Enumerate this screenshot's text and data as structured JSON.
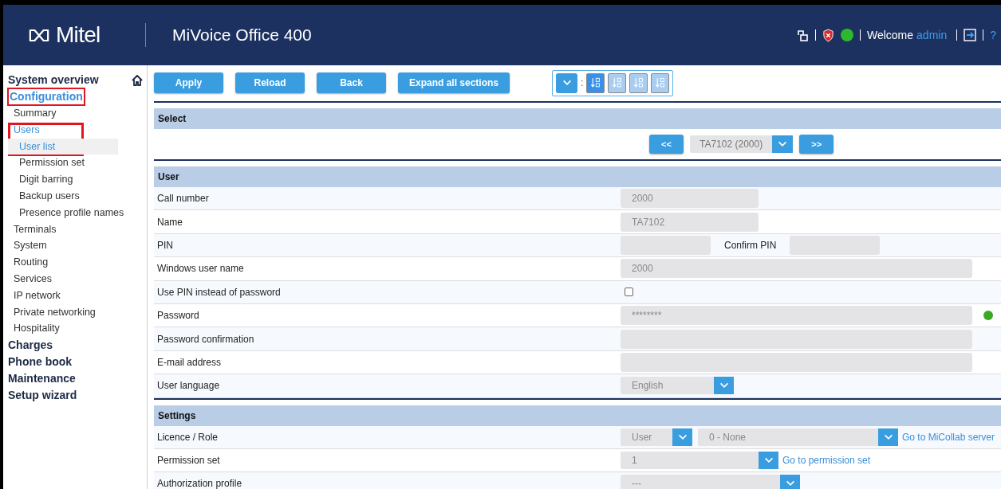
{
  "header": {
    "logo": "Mitel",
    "title": "MiVoice Office 400",
    "welcome": "Welcome",
    "user": "admin",
    "help": "?"
  },
  "sidebar": {
    "items": [
      {
        "label": "System overview",
        "selected": false,
        "highlighted": false
      },
      {
        "label": "Configuration",
        "selected": true,
        "highlighted": true,
        "children": [
          {
            "label": "Summary",
            "selected": false,
            "highlighted": false
          },
          {
            "label": "Users",
            "selected": true,
            "highlighted": true,
            "children": [
              {
                "label": "User list",
                "selected": true,
                "highlighted": true
              },
              {
                "label": "Permission set",
                "selected": false,
                "highlighted": false
              },
              {
                "label": "Digit barring",
                "selected": false,
                "highlighted": false
              },
              {
                "label": "Backup users",
                "selected": false,
                "highlighted": false
              },
              {
                "label": "Presence profile names",
                "selected": false,
                "highlighted": false
              }
            ]
          },
          {
            "label": "Terminals",
            "selected": false,
            "highlighted": false
          },
          {
            "label": "System",
            "selected": false,
            "highlighted": false
          },
          {
            "label": "Routing",
            "selected": false,
            "highlighted": false
          },
          {
            "label": "Services",
            "selected": false,
            "highlighted": false
          },
          {
            "label": "IP network",
            "selected": false,
            "highlighted": false
          },
          {
            "label": "Private networking",
            "selected": false,
            "highlighted": false
          },
          {
            "label": "Hospitality",
            "selected": false,
            "highlighted": false
          }
        ]
      },
      {
        "label": "Charges",
        "selected": false,
        "highlighted": false
      },
      {
        "label": "Phone book",
        "selected": false,
        "highlighted": false
      },
      {
        "label": "Maintenance",
        "selected": false,
        "highlighted": false
      },
      {
        "label": "Setup wizard",
        "selected": false,
        "highlighted": false
      }
    ]
  },
  "toolbar": {
    "buttons": [
      "Apply",
      "Reload",
      "Back",
      "Expand all sections"
    ],
    "sort_separator": ":",
    "sort_buttons": [
      {
        "selected": true
      },
      {
        "selected": false
      },
      {
        "selected": false
      },
      {
        "selected": false
      }
    ]
  },
  "select_section": {
    "title": "Select",
    "prev": "<<",
    "current": "TA7102 (2000)",
    "next": ">>"
  },
  "sections": [
    {
      "title": "User",
      "rows": [
        {
          "label": "Call number",
          "fields": [
            {
              "kind": "input",
              "value": "2000"
            }
          ]
        },
        {
          "label": "Name",
          "fields": [
            {
              "kind": "input",
              "value": "TA7102"
            }
          ]
        },
        {
          "label": "PIN",
          "fields": [
            {
              "kind": "input"
            },
            {
              "kind": "label",
              "text": "Confirm PIN"
            },
            {
              "kind": "input"
            }
          ]
        },
        {
          "label": "Windows user name",
          "fields": [
            {
              "kind": "input",
              "value": "2000"
            }
          ]
        },
        {
          "label": "Use PIN instead of password",
          "fields": [
            {
              "kind": "checkbox",
              "checked": false
            }
          ]
        },
        {
          "label": "Password",
          "fields": [
            {
              "kind": "input",
              "value": "********"
            },
            {
              "kind": "status"
            }
          ]
        },
        {
          "label": "Password confirmation",
          "fields": [
            {
              "kind": "input"
            }
          ]
        },
        {
          "label": "E-mail address",
          "fields": [
            {
              "kind": "input"
            }
          ]
        },
        {
          "label": "User language",
          "fields": [
            {
              "kind": "select",
              "value": "English"
            }
          ]
        }
      ]
    },
    {
      "title": "Settings",
      "rows": [
        {
          "label": "Licence / Role",
          "fields": [
            {
              "kind": "select",
              "value": "User"
            },
            {
              "kind": "select",
              "value": "0 - None"
            },
            {
              "kind": "link",
              "text": "Go to MiCollab server"
            }
          ]
        },
        {
          "label": "Permission set",
          "fields": [
            {
              "kind": "select",
              "value": "1"
            },
            {
              "kind": "link",
              "text": "Go to permission set"
            }
          ]
        },
        {
          "label": "Authorization profile",
          "fields": [
            {
              "kind": "select",
              "value": "---"
            }
          ]
        }
      ]
    }
  ]
}
